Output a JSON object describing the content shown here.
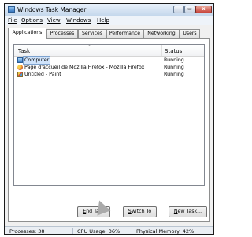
{
  "window": {
    "title": "Windows Task Manager",
    "minimize_glyph": "–",
    "maximize_glyph": "▭",
    "close_glyph": "x"
  },
  "menu": [
    "File",
    "Options",
    "View",
    "Windows",
    "Help"
  ],
  "tabs": [
    {
      "label": "Applications",
      "active": true
    },
    {
      "label": "Processes",
      "active": false
    },
    {
      "label": "Services",
      "active": false
    },
    {
      "label": "Performance",
      "active": false
    },
    {
      "label": "Networking",
      "active": false
    },
    {
      "label": "Users",
      "active": false
    }
  ],
  "list": {
    "columns": {
      "task": "Task",
      "status": "Status"
    },
    "sort_glyph": "ˆ",
    "rows": [
      {
        "task": "Computer",
        "status": "Running",
        "icon": "computer-icon",
        "selected": true
      },
      {
        "task": "Page d'accueil de Mozilla Firefox - Mozilla Firefox",
        "status": "Running",
        "icon": "firefox-icon",
        "selected": false
      },
      {
        "task": "Untitled - Paint",
        "status": "Running",
        "icon": "paint-icon",
        "selected": false
      }
    ]
  },
  "buttons": {
    "end_task_key": "E",
    "end_task_rest": "nd Task",
    "switch_to_key": "S",
    "switch_to_rest": "witch To",
    "new_task_key": "N",
    "new_task_rest": "ew Task..."
  },
  "status_bar": {
    "processes": "Processes: 38",
    "cpu": "CPU Usage: 36%",
    "memory": "Physical Memory: 42%"
  }
}
